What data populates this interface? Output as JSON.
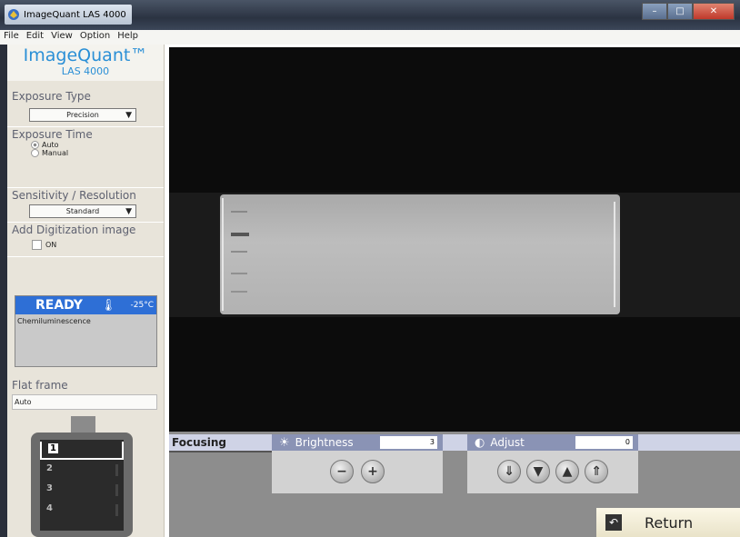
{
  "window": {
    "title": "ImageQuant LAS 4000"
  },
  "menu": [
    "File",
    "Edit",
    "View",
    "Option",
    "Help"
  ],
  "logo": {
    "name": "ImageQuant™",
    "model": "LAS 4000"
  },
  "exposure_type": {
    "label": "Exposure Type",
    "selected": "Precision"
  },
  "exposure_time": {
    "label": "Exposure Time",
    "options": [
      "Auto",
      "Manual"
    ],
    "selected": "Auto"
  },
  "sensitivity": {
    "label": "Sensitivity / Resolution",
    "selected": "Standard"
  },
  "digitization": {
    "label": "Add Digitization image",
    "checkbox_label": "ON",
    "checked": false
  },
  "status": {
    "state": "READY",
    "temperature": "-25°C",
    "mode": "Chemiluminescence"
  },
  "flat_frame": {
    "label": "Flat frame",
    "value": "Auto"
  },
  "tray": {
    "slots": [
      "1",
      "2",
      "3",
      "4"
    ],
    "selected": "1"
  },
  "controls": {
    "focusing": "Focusing",
    "brightness": {
      "label": "Brightness",
      "value": "3"
    },
    "adjust": {
      "label": "Adjust",
      "value": "0"
    }
  },
  "return_label": "Return",
  "colors": {
    "accent_blue": "#2e6fd6",
    "logo_blue": "#2a8fd6",
    "panel_header": "#8a93b5"
  }
}
